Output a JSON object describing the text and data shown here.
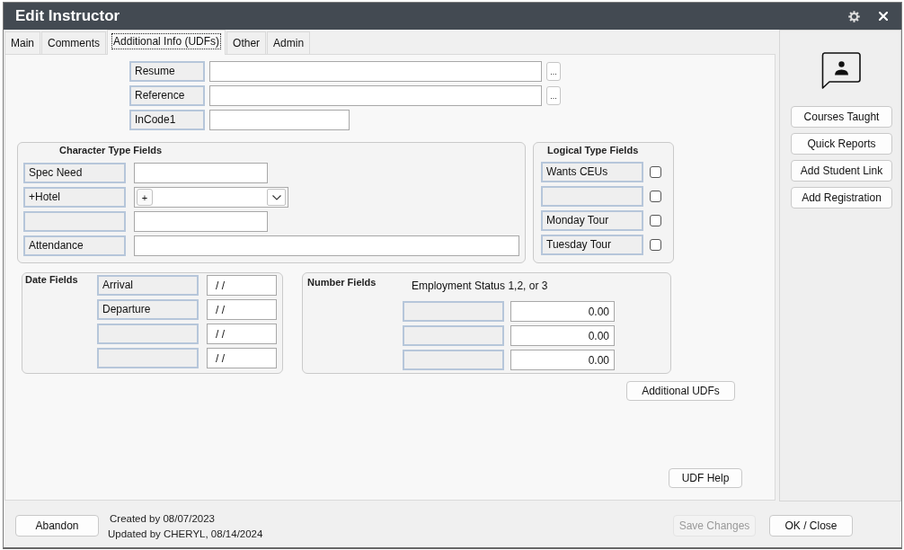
{
  "window": {
    "title": "Edit Instructor"
  },
  "tabs": [
    {
      "label": "Main",
      "selected": false
    },
    {
      "label": "Comments",
      "selected": false
    },
    {
      "label": "Additional Info (UDFs)",
      "selected": true
    },
    {
      "label": "Other",
      "selected": false
    },
    {
      "label": "Admin",
      "selected": false
    }
  ],
  "top_fields": [
    {
      "label": "Resume",
      "kind": "browse",
      "button": "..."
    },
    {
      "label": "Reference",
      "kind": "browse",
      "button": "..."
    },
    {
      "label": "InCode1",
      "kind": "short"
    }
  ],
  "character_fields": {
    "title": "Character Type Fields",
    "rows": [
      {
        "label": "Spec Need",
        "kind": "text"
      },
      {
        "label": "+Hotel",
        "kind": "combo",
        "button": "+"
      },
      {
        "kind": "text"
      },
      {
        "label": "Attendance",
        "kind": "wide"
      }
    ]
  },
  "logical_fields": {
    "title": "Logical Type Fields",
    "rows": [
      {
        "label": "Wants CEUs",
        "checked": false
      },
      {
        "checked": false
      },
      {
        "label": "Monday Tour",
        "checked": false
      },
      {
        "label": "Tuesday Tour",
        "checked": false
      }
    ]
  },
  "date_fields": {
    "title": "Date Fields",
    "rows": [
      {
        "label": "Arrival",
        "value": "/ /"
      },
      {
        "label": "Departure",
        "value": "/ /"
      },
      {
        "value": "/ /"
      },
      {
        "value": "/ /"
      }
    ]
  },
  "number_fields": {
    "title": "Number Fields",
    "heading": "Employment Status 1,2, or 3",
    "rows": [
      {
        "value": "0.00"
      },
      {
        "value": "0.00"
      },
      {
        "value": "0.00"
      }
    ]
  },
  "form_buttons": {
    "additional": "Additional UDFs",
    "help": "UDF Help"
  },
  "sidebar": {
    "buttons": [
      "Courses Taught",
      "Quick Reports",
      "Add Student Link",
      "Add Registration"
    ]
  },
  "footer": {
    "abandon": "Abandon",
    "created": "Created by 08/07/2023",
    "updated": "Updated by CHERYL, 08/14/2024",
    "save": {
      "label": "Save Changes",
      "disabled": true
    },
    "ok": "OK / Close"
  }
}
